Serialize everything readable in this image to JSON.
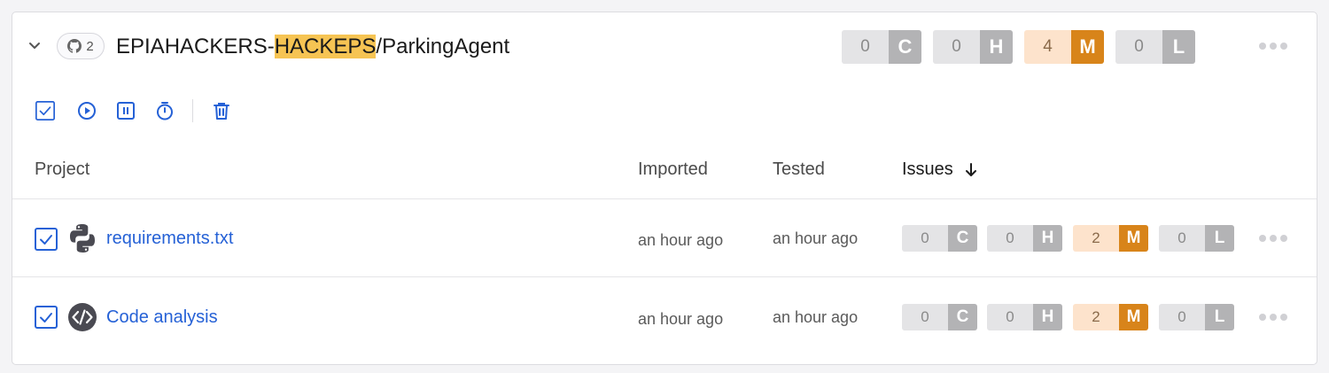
{
  "header": {
    "repo_count": "2",
    "repo_owner_prefix": "EPIAHACKERS-",
    "repo_owner_highlight": "HACKEPS",
    "repo_name_suffix": "/ParkingAgent",
    "severity": {
      "critical": {
        "count": "0",
        "letter": "C"
      },
      "high": {
        "count": "0",
        "letter": "H"
      },
      "medium": {
        "count": "4",
        "letter": "M"
      },
      "low": {
        "count": "0",
        "letter": "L"
      }
    }
  },
  "toolbar": [
    "select-all",
    "run-test",
    "pause",
    "schedule-timer",
    "delete"
  ],
  "table": {
    "columns": {
      "project": "Project",
      "imported": "Imported",
      "tested": "Tested",
      "issues": "Issues"
    },
    "rows": [
      {
        "name": "requirements.txt",
        "icon": "python-icon",
        "imported": "an hour ago",
        "tested": "an hour ago",
        "severity": {
          "c": "0",
          "h": "0",
          "m": "2",
          "l": "0"
        },
        "letters": {
          "c": "C",
          "h": "H",
          "m": "M",
          "l": "L"
        }
      },
      {
        "name": "Code analysis",
        "icon": "code-icon",
        "imported": "an hour ago",
        "tested": "an hour ago",
        "severity": {
          "c": "0",
          "h": "0",
          "m": "2",
          "l": "0"
        },
        "letters": {
          "c": "C",
          "h": "H",
          "m": "M",
          "l": "L"
        }
      }
    ]
  },
  "colors": {
    "accent": "#2561d6",
    "medium_severity": "#d8841a",
    "medium_severity_bg": "#fde3cc",
    "highlight": "#f6c453",
    "neutral_severity": "#b3b3b5"
  }
}
